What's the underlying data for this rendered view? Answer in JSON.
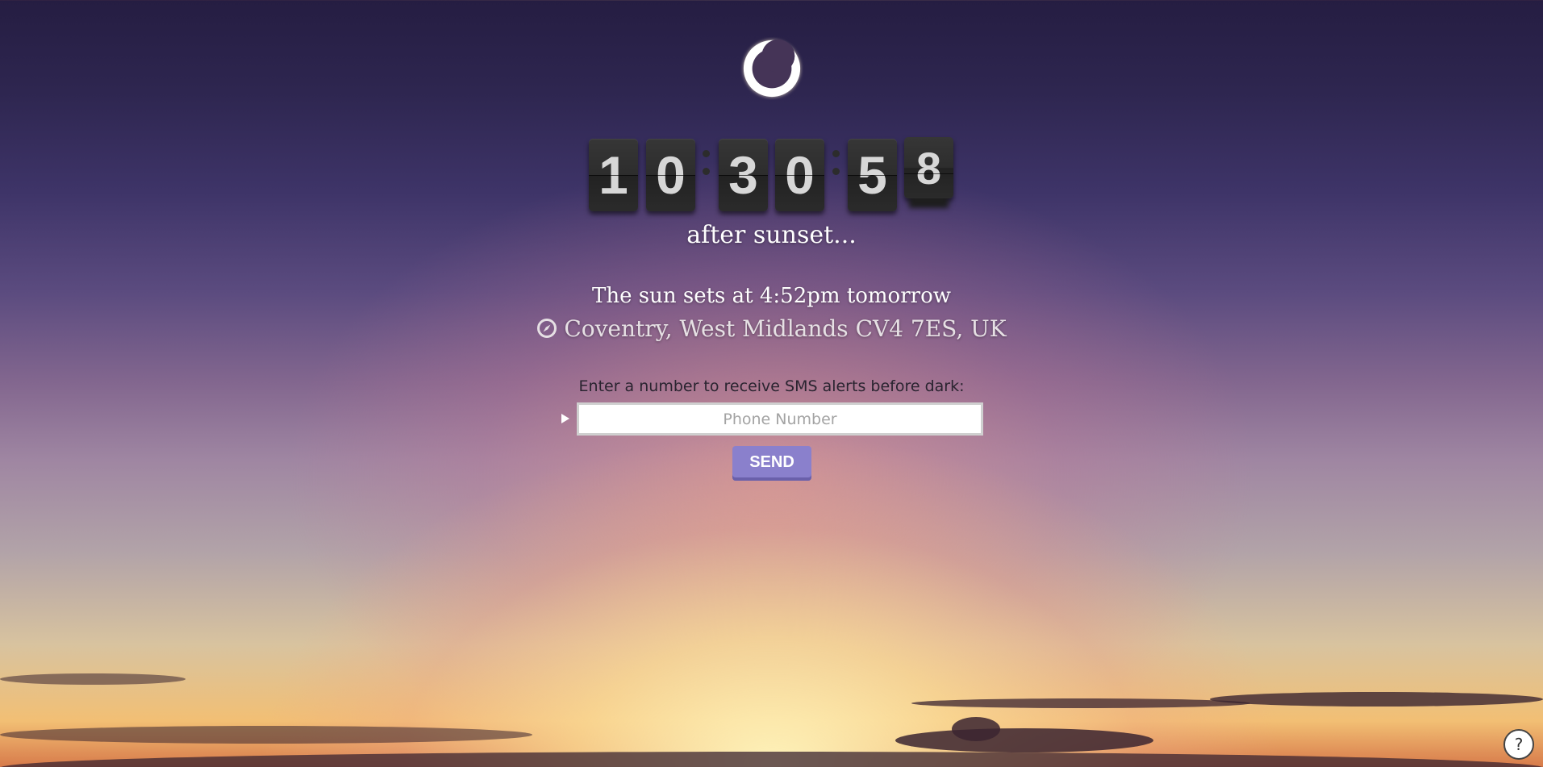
{
  "countdown": {
    "digits": [
      "1",
      "0",
      "3",
      "0",
      "5",
      "8"
    ]
  },
  "status_text": "after sunset...",
  "sunset": {
    "text": "The sun sets at 4:52pm tomorrow",
    "location": "Coventry, West Midlands CV4 7ES, UK"
  },
  "sms": {
    "label": "Enter a number to receive SMS alerts before dark:",
    "placeholder": "Phone Number",
    "send_label": "SEND"
  },
  "help": {
    "label": "?"
  },
  "icons": {
    "logo": "crescent-moon-icon",
    "location": "compass-icon",
    "input_marker": "play-arrow-icon"
  },
  "colors": {
    "send_button": "#8a80cc",
    "clock_tile": "#2d2d2d",
    "clock_digit": "#d7d7d7"
  }
}
